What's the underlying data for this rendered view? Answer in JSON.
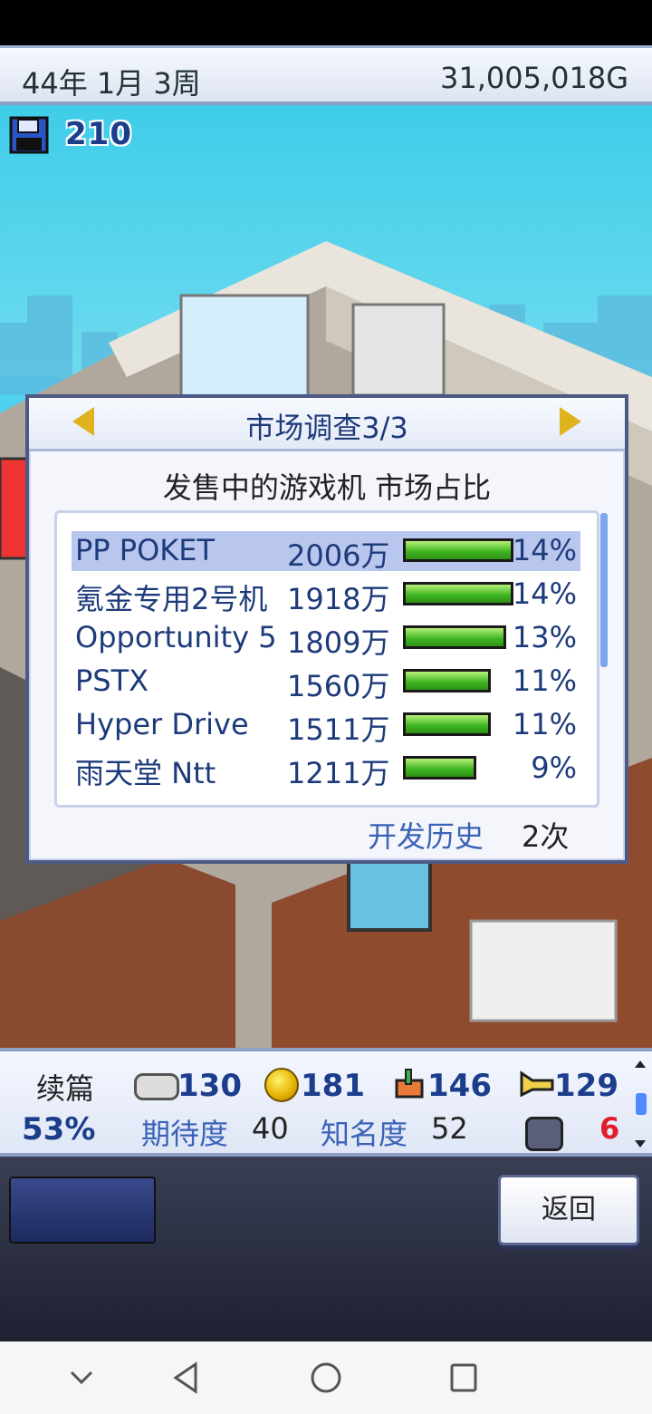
{
  "header": {
    "date": "44年 1月 3周",
    "money": "31,005,018G"
  },
  "save": {
    "icon": "floppy-disk-icon",
    "count": "210"
  },
  "dialog": {
    "title": "市场调查3/3",
    "subtitle": "发售中的游戏机 市场占比",
    "consoles": [
      {
        "name": "PP POKET",
        "sales": "2006万",
        "share": "14%",
        "share_value": 14,
        "selected": true
      },
      {
        "name": "氪金专用2号机",
        "sales": "1918万",
        "share": "14%",
        "share_value": 14
      },
      {
        "name": "Opportunity 5",
        "sales": "1809万",
        "share": "13%",
        "share_value": 13
      },
      {
        "name": "PSTX",
        "sales": "1560万",
        "share": "11%",
        "share_value": 11
      },
      {
        "name": "Hyper Drive",
        "sales": "1511万",
        "share": "11%",
        "share_value": 11
      },
      {
        "name": "雨天堂 Ntt",
        "sales": "1211万",
        "share": "9%",
        "share_value": 9
      }
    ],
    "history_label": "开发历史",
    "history_value": "2次"
  },
  "info": {
    "label_sequel": "续篇",
    "percent": "53%",
    "fun": "130",
    "creativity": "181",
    "graphics": "146",
    "sound": "129",
    "expect_label": "期待度",
    "expect_value": "40",
    "fame_label": "知名度",
    "fame_value": "52",
    "red_count": "6"
  },
  "buttons": {
    "back": "返回"
  },
  "colors": {
    "bar_green": "#3cb51e",
    "title_blue": "#1d3a7a",
    "history_blue": "#3a62b8"
  }
}
